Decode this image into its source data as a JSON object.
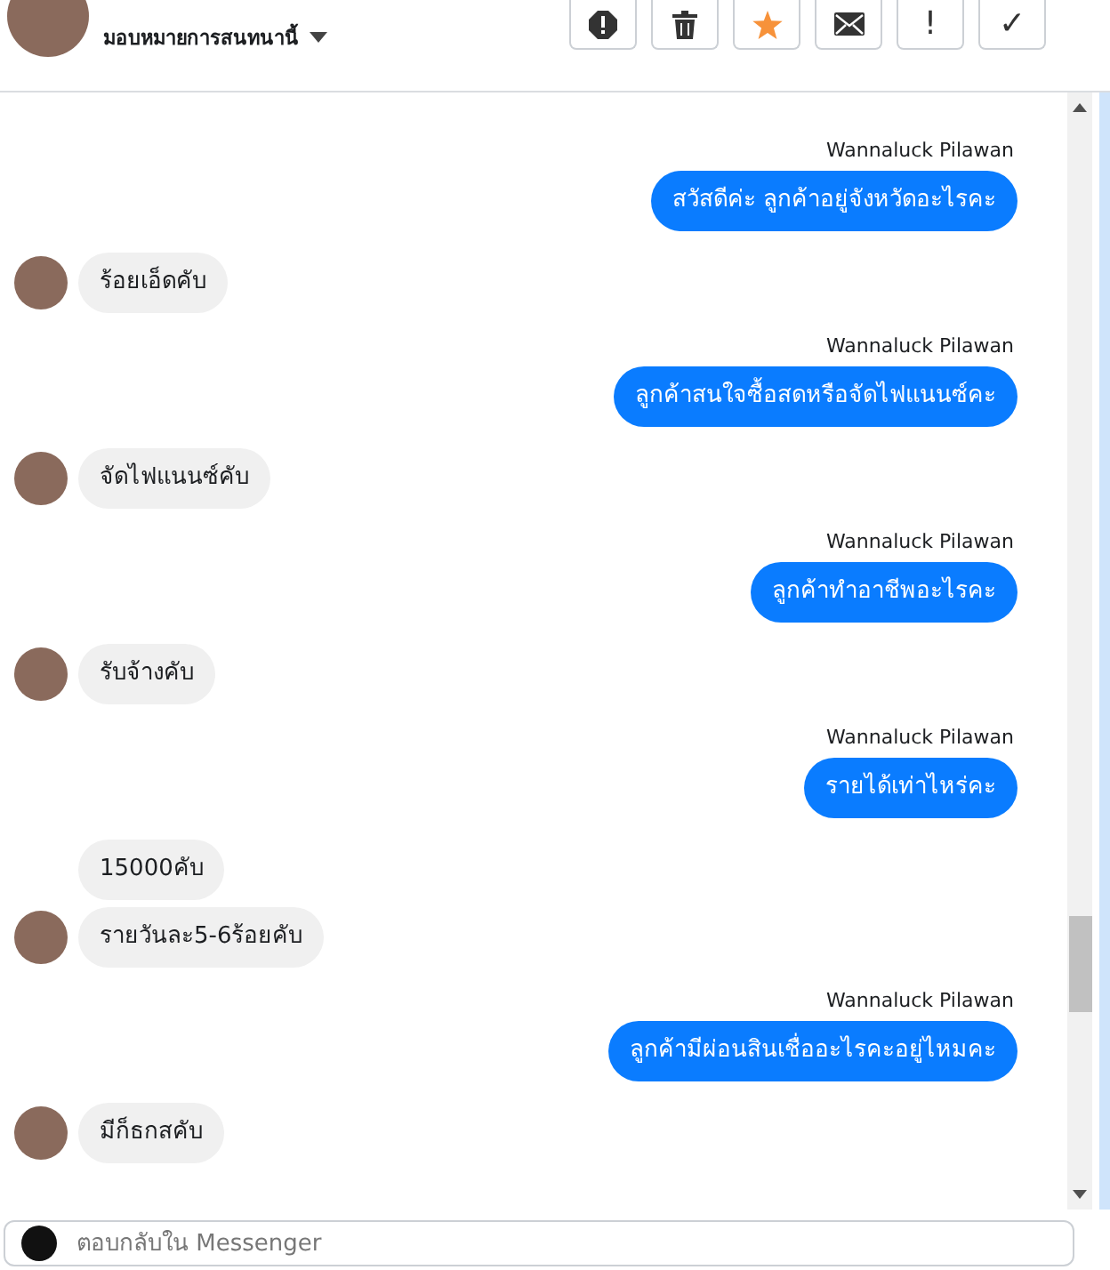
{
  "header": {
    "assign_label": "มอบหมายการสนทนานี้",
    "buttons": [
      {
        "kind": "alert"
      },
      {
        "kind": "trash"
      },
      {
        "kind": "star"
      },
      {
        "kind": "mail"
      },
      {
        "kind": "text",
        "label": "!"
      },
      {
        "kind": "text",
        "label": "✓"
      }
    ]
  },
  "messages": [
    {
      "kind": "outgoing",
      "sender": "Wannaluck Pilawan",
      "texts": [
        "สวัสดีค่ะ ลูกค้าอยู่จังหวัดอะไรคะ"
      ]
    },
    {
      "kind": "incoming",
      "texts": [
        "ร้อยเอ็ดคับ"
      ]
    },
    {
      "kind": "outgoing",
      "sender": "Wannaluck Pilawan",
      "texts": [
        "ลูกค้าสนใจซื้อสดหรือจัดไฟแนนซ์คะ"
      ]
    },
    {
      "kind": "incoming",
      "texts": [
        "จัดไฟแนนซ์คับ"
      ]
    },
    {
      "kind": "outgoing",
      "sender": "Wannaluck Pilawan",
      "texts": [
        "ลูกค้าทำอาชีพอะไรคะ"
      ]
    },
    {
      "kind": "incoming",
      "texts": [
        "รับจ้างคับ"
      ]
    },
    {
      "kind": "outgoing",
      "sender": "Wannaluck Pilawan",
      "texts": [
        "รายได้เท่าไหร่คะ"
      ]
    },
    {
      "kind": "incoming",
      "texts": [
        "15000คับ",
        "รายวันละ5-6ร้อยคับ"
      ]
    },
    {
      "kind": "outgoing",
      "sender": "Wannaluck Pilawan",
      "texts": [
        "ลูกค้ามีผ่อนสินเชื่ออะไรคะอยู่ไหมคะ"
      ]
    },
    {
      "kind": "incoming",
      "texts": [
        "มีก็ธกสคับ"
      ]
    }
  ],
  "composer": {
    "placeholder": "ตอบกลับใน Messenger"
  }
}
